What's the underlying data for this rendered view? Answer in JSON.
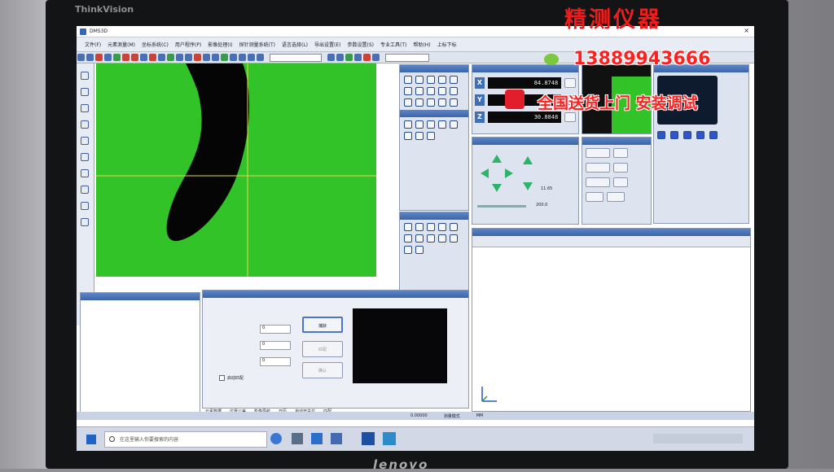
{
  "monitor": {
    "brand_top": "ThinkVision",
    "brand_bottom": "lenovo"
  },
  "overlay": {
    "title": "精测仪器",
    "phone": "13889943666",
    "service": "全国送货上门 安装调试"
  },
  "app": {
    "title": "DMS3D"
  },
  "menu": [
    "文件(F)",
    "元素测量(M)",
    "坐标系统(C)",
    "用户程序(P)",
    "影像处理(I)",
    "探针测量系统(T)",
    "语言选择(L)",
    "导出设置(E)",
    "参数设置(S)",
    "专业工具(T)",
    "帮助(H)",
    "上标下标"
  ],
  "dro": {
    "x": "84.8748",
    "y": "",
    "z": "30.8848"
  },
  "stage": {
    "zoom": "11.65",
    "speed": "200.0"
  },
  "search": {
    "placeholder": "在这里输入你要搜索的内容"
  },
  "bottom_tabs": [
    "元素数据",
    "位置公差",
    "影像导航",
    "日历",
    "自动开关位",
    "匹配"
  ],
  "statusbar": {
    "coord": "0.00000",
    "unit": "MM",
    "mode": "测量模式"
  },
  "match": {
    "btn_learn": "捕获",
    "btn2": "匹配",
    "btn3": "确认",
    "label_check": "启动匹配",
    "field1": "0",
    "field2": "0",
    "field3": "0"
  },
  "colors": {
    "green": "#32c328",
    "overlay_red": "#f01c1c",
    "header_blue": "#3b64a8"
  }
}
